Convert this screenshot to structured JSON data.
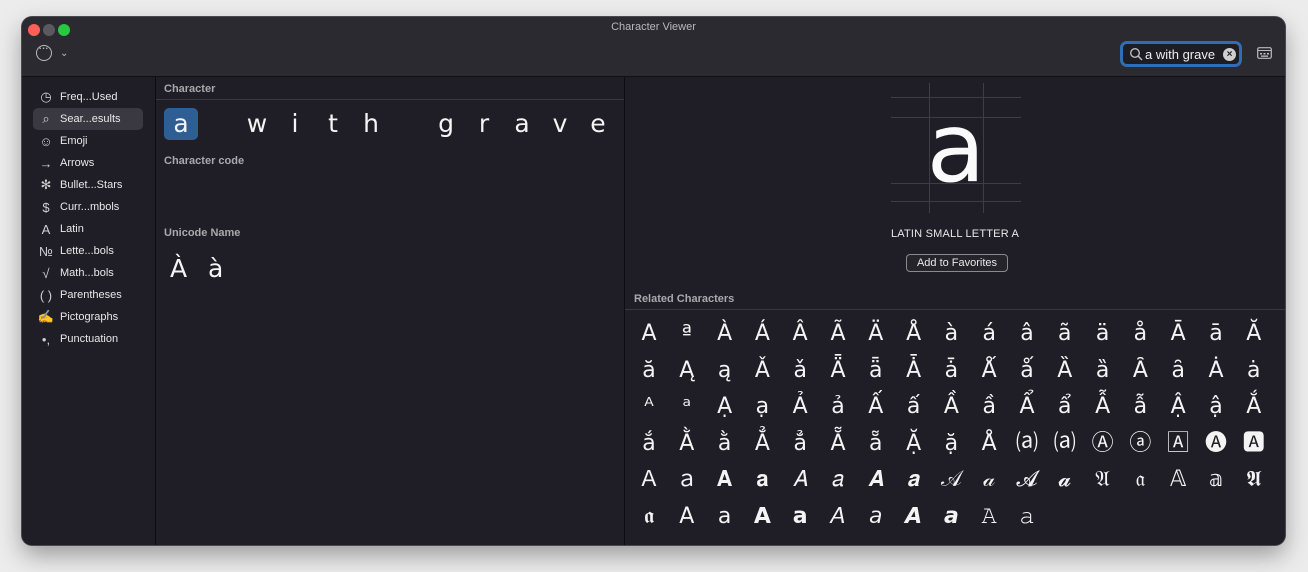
{
  "window": {
    "title": "Character Viewer"
  },
  "search": {
    "value": "a with grave"
  },
  "sidebar": {
    "items": [
      {
        "icon": "◷",
        "label": "Freq...Used"
      },
      {
        "icon": "⌕",
        "label": "Sear...esults"
      },
      {
        "icon": "☺",
        "label": "Emoji"
      },
      {
        "icon": "→",
        "label": "Arrows"
      },
      {
        "icon": "✻",
        "label": "Bullet...Stars"
      },
      {
        "icon": "$",
        "label": "Curr...mbols"
      },
      {
        "icon": "A",
        "label": "Latin"
      },
      {
        "icon": "№",
        "label": "Lette...bols"
      },
      {
        "icon": "√",
        "label": "Math...bols"
      },
      {
        "icon": "( )",
        "label": "Parentheses"
      },
      {
        "icon": "✍",
        "label": "Pictographs"
      },
      {
        "icon": "•,",
        "label": "Punctuation"
      }
    ],
    "selected_index": 1
  },
  "middle": {
    "character_heading": "Character",
    "characters": [
      "a",
      "w",
      "i",
      "t",
      "h",
      "g",
      "r",
      "a",
      "v",
      "e"
    ],
    "character_code_heading": "Character code",
    "unicode_name_heading": "Unicode Name",
    "unicode_results": [
      "À",
      "à"
    ]
  },
  "detail": {
    "glyph": "a",
    "name": "LATIN SMALL LETTER A",
    "add_favorites": "Add to Favorites"
  },
  "related": {
    "heading": "Related Characters",
    "chars": [
      "A",
      "ª",
      "À",
      "Á",
      "Â",
      "Ã",
      "Ä",
      "Å",
      "à",
      "á",
      "â",
      "ã",
      "ä",
      "å",
      "Ā",
      "ā",
      "Ă",
      "ă",
      "Ą",
      "ą",
      "Ǎ",
      "ǎ",
      "Ǟ",
      "ǟ",
      "Ǡ",
      "ǡ",
      "Ǻ",
      "ǻ",
      "Ȁ",
      "ȁ",
      "Ȃ",
      "ȃ",
      "Ȧ",
      "ȧ",
      "ᴬ",
      "ᵃ",
      "Ạ",
      "ạ",
      "Ả",
      "ả",
      "Ấ",
      "ấ",
      "Ầ",
      "ầ",
      "Ẩ",
      "ẩ",
      "Ẫ",
      "ẫ",
      "Ậ",
      "ậ",
      "Ắ",
      "ắ",
      "Ằ",
      "ằ",
      "Ẳ",
      "ẳ",
      "Ẵ",
      "ẵ",
      "Ặ",
      "ặ",
      "Å",
      "⒜",
      "⒜",
      "Ⓐ",
      "ⓐ",
      "🄰",
      "🅐",
      "🅰",
      "Ａ",
      "ａ",
      "𝐀",
      "𝐚",
      "𝐴",
      "𝑎",
      "𝑨",
      "𝒂",
      "𝒜",
      "𝒶",
      "𝓐",
      "𝓪",
      "𝔄",
      "𝔞",
      "𝔸",
      "𝕒",
      "𝕬",
      "𝖆",
      "𝖠",
      "𝖺",
      "𝗔",
      "𝗮",
      "𝘈",
      "𝘢",
      "𝘼",
      "𝙖",
      "𝙰",
      "𝚊"
    ]
  }
}
